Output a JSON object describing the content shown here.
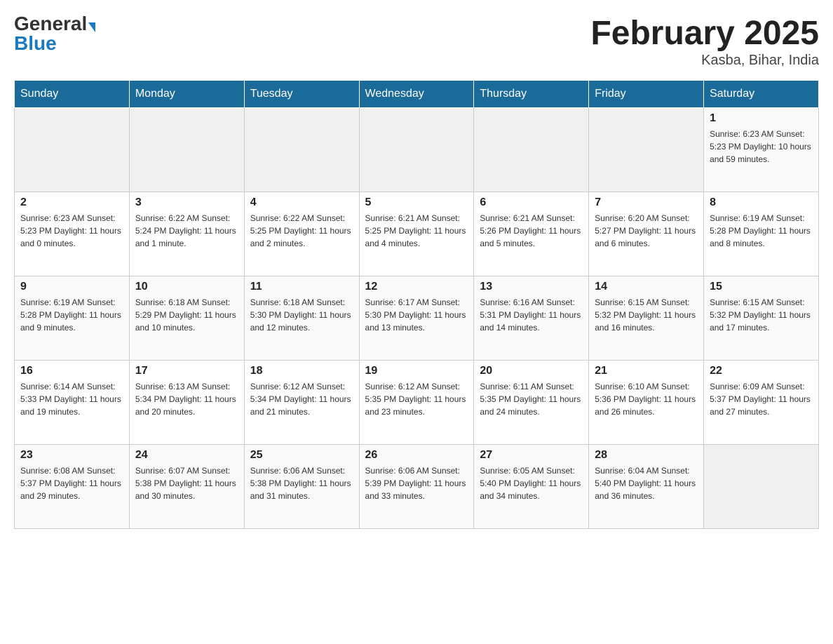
{
  "logo": {
    "general": "General",
    "blue": "Blue"
  },
  "title": "February 2025",
  "location": "Kasba, Bihar, India",
  "headers": [
    "Sunday",
    "Monday",
    "Tuesday",
    "Wednesday",
    "Thursday",
    "Friday",
    "Saturday"
  ],
  "weeks": [
    [
      {
        "day": "",
        "info": ""
      },
      {
        "day": "",
        "info": ""
      },
      {
        "day": "",
        "info": ""
      },
      {
        "day": "",
        "info": ""
      },
      {
        "day": "",
        "info": ""
      },
      {
        "day": "",
        "info": ""
      },
      {
        "day": "1",
        "info": "Sunrise: 6:23 AM\nSunset: 5:23 PM\nDaylight: 10 hours\nand 59 minutes."
      }
    ],
    [
      {
        "day": "2",
        "info": "Sunrise: 6:23 AM\nSunset: 5:23 PM\nDaylight: 11 hours\nand 0 minutes."
      },
      {
        "day": "3",
        "info": "Sunrise: 6:22 AM\nSunset: 5:24 PM\nDaylight: 11 hours\nand 1 minute."
      },
      {
        "day": "4",
        "info": "Sunrise: 6:22 AM\nSunset: 5:25 PM\nDaylight: 11 hours\nand 2 minutes."
      },
      {
        "day": "5",
        "info": "Sunrise: 6:21 AM\nSunset: 5:25 PM\nDaylight: 11 hours\nand 4 minutes."
      },
      {
        "day": "6",
        "info": "Sunrise: 6:21 AM\nSunset: 5:26 PM\nDaylight: 11 hours\nand 5 minutes."
      },
      {
        "day": "7",
        "info": "Sunrise: 6:20 AM\nSunset: 5:27 PM\nDaylight: 11 hours\nand 6 minutes."
      },
      {
        "day": "8",
        "info": "Sunrise: 6:19 AM\nSunset: 5:28 PM\nDaylight: 11 hours\nand 8 minutes."
      }
    ],
    [
      {
        "day": "9",
        "info": "Sunrise: 6:19 AM\nSunset: 5:28 PM\nDaylight: 11 hours\nand 9 minutes."
      },
      {
        "day": "10",
        "info": "Sunrise: 6:18 AM\nSunset: 5:29 PM\nDaylight: 11 hours\nand 10 minutes."
      },
      {
        "day": "11",
        "info": "Sunrise: 6:18 AM\nSunset: 5:30 PM\nDaylight: 11 hours\nand 12 minutes."
      },
      {
        "day": "12",
        "info": "Sunrise: 6:17 AM\nSunset: 5:30 PM\nDaylight: 11 hours\nand 13 minutes."
      },
      {
        "day": "13",
        "info": "Sunrise: 6:16 AM\nSunset: 5:31 PM\nDaylight: 11 hours\nand 14 minutes."
      },
      {
        "day": "14",
        "info": "Sunrise: 6:15 AM\nSunset: 5:32 PM\nDaylight: 11 hours\nand 16 minutes."
      },
      {
        "day": "15",
        "info": "Sunrise: 6:15 AM\nSunset: 5:32 PM\nDaylight: 11 hours\nand 17 minutes."
      }
    ],
    [
      {
        "day": "16",
        "info": "Sunrise: 6:14 AM\nSunset: 5:33 PM\nDaylight: 11 hours\nand 19 minutes."
      },
      {
        "day": "17",
        "info": "Sunrise: 6:13 AM\nSunset: 5:34 PM\nDaylight: 11 hours\nand 20 minutes."
      },
      {
        "day": "18",
        "info": "Sunrise: 6:12 AM\nSunset: 5:34 PM\nDaylight: 11 hours\nand 21 minutes."
      },
      {
        "day": "19",
        "info": "Sunrise: 6:12 AM\nSunset: 5:35 PM\nDaylight: 11 hours\nand 23 minutes."
      },
      {
        "day": "20",
        "info": "Sunrise: 6:11 AM\nSunset: 5:35 PM\nDaylight: 11 hours\nand 24 minutes."
      },
      {
        "day": "21",
        "info": "Sunrise: 6:10 AM\nSunset: 5:36 PM\nDaylight: 11 hours\nand 26 minutes."
      },
      {
        "day": "22",
        "info": "Sunrise: 6:09 AM\nSunset: 5:37 PM\nDaylight: 11 hours\nand 27 minutes."
      }
    ],
    [
      {
        "day": "23",
        "info": "Sunrise: 6:08 AM\nSunset: 5:37 PM\nDaylight: 11 hours\nand 29 minutes."
      },
      {
        "day": "24",
        "info": "Sunrise: 6:07 AM\nSunset: 5:38 PM\nDaylight: 11 hours\nand 30 minutes."
      },
      {
        "day": "25",
        "info": "Sunrise: 6:06 AM\nSunset: 5:38 PM\nDaylight: 11 hours\nand 31 minutes."
      },
      {
        "day": "26",
        "info": "Sunrise: 6:06 AM\nSunset: 5:39 PM\nDaylight: 11 hours\nand 33 minutes."
      },
      {
        "day": "27",
        "info": "Sunrise: 6:05 AM\nSunset: 5:40 PM\nDaylight: 11 hours\nand 34 minutes."
      },
      {
        "day": "28",
        "info": "Sunrise: 6:04 AM\nSunset: 5:40 PM\nDaylight: 11 hours\nand 36 minutes."
      },
      {
        "day": "",
        "info": ""
      }
    ]
  ]
}
